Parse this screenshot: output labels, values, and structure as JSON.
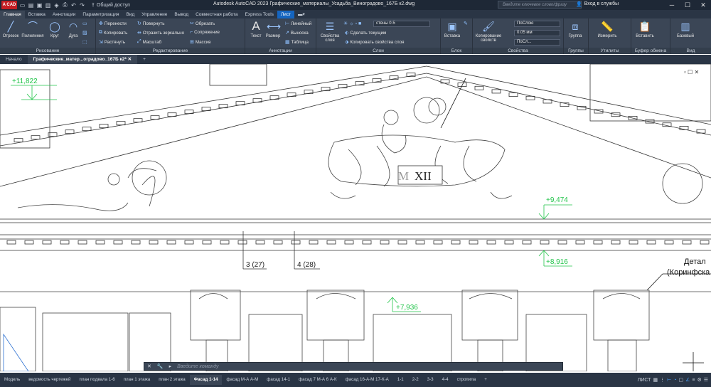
{
  "app": {
    "logo": "A CAD",
    "title": "Autodesk AutoCAD 2023   Графические_материалы_Усадьба_Виноградово_167Б к2.dwg",
    "share": "Общий доступ",
    "search_placeholder": "Введите ключевое слово/фразу",
    "login": "Вход в службы"
  },
  "ribbon_tabs": [
    "Главная",
    "Вставка",
    "Аннотации",
    "Параметризация",
    "Вид",
    "Управление",
    "Вывод",
    "Совместная работа",
    "Express Tools",
    "Лист"
  ],
  "panels": {
    "draw": {
      "title": "Рисование",
      "tools": [
        "Отрезок",
        "Полилиния",
        "Круг",
        "Дуга"
      ]
    },
    "modify": {
      "title": "Редактирование",
      "items": [
        "Перенести",
        "Повернуть",
        "Обрезать",
        "Копировать",
        "Отразить зеркально",
        "Сопряжение",
        "Растянуть",
        "Масштаб",
        "Массив"
      ]
    },
    "annot": {
      "title": "Аннотации",
      "tools": [
        "Текст",
        "Размер"
      ],
      "items": [
        "Линейный",
        "Выноска",
        "Таблица"
      ]
    },
    "layers": {
      "title": "Слои",
      "big": "Свойства слоя",
      "layer": "стены 0.5",
      "items": [
        "Сделать текущим",
        "Копировать свойства слоя"
      ]
    },
    "block": {
      "title": "Блок",
      "big": "Вставка"
    },
    "props": {
      "title": "Свойства",
      "big": "Копирование свойств",
      "color": "ПоСлою",
      "lw": "0.05 мм",
      "lt": "ПоСл..."
    },
    "groups": {
      "title": "Группы",
      "big": "Группа"
    },
    "utils": {
      "title": "Утилиты",
      "big": "Измерить"
    },
    "clip": {
      "title": "Буфер обмена",
      "big": "Вставить"
    },
    "view": {
      "title": "Вид",
      "big": "Базовый"
    }
  },
  "doc_tabs": [
    "Начало",
    "Графические_матер...оградово_167Б к2*"
  ],
  "drawing": {
    "elevations": [
      "+11,822",
      "+9,474",
      "+8,916",
      "+7,936"
    ],
    "labels": [
      "3 (27)",
      "4 (28)"
    ],
    "roman": "XII",
    "note_1": "Детал",
    "note_2": "(Коринфска"
  },
  "command": {
    "placeholder": "Введите команду"
  },
  "layout_tabs": [
    "Модель",
    "ведомость чертежей",
    "план подвала 1-6",
    "план 1 этажа",
    "план 2 этажа",
    "Фасад 1-14",
    "фасад М-А  А-М",
    "фасад 14-1",
    "фасад 7 М-А 6 А-К",
    "фасад 16-А-М 17-К-А",
    "1-1",
    "2-2",
    "3-3",
    "4-4",
    "стропила"
  ],
  "status": {
    "mode": "ЛИСТ"
  },
  "colors": {
    "accent": "#1565c0",
    "dim": "#22c44a"
  }
}
